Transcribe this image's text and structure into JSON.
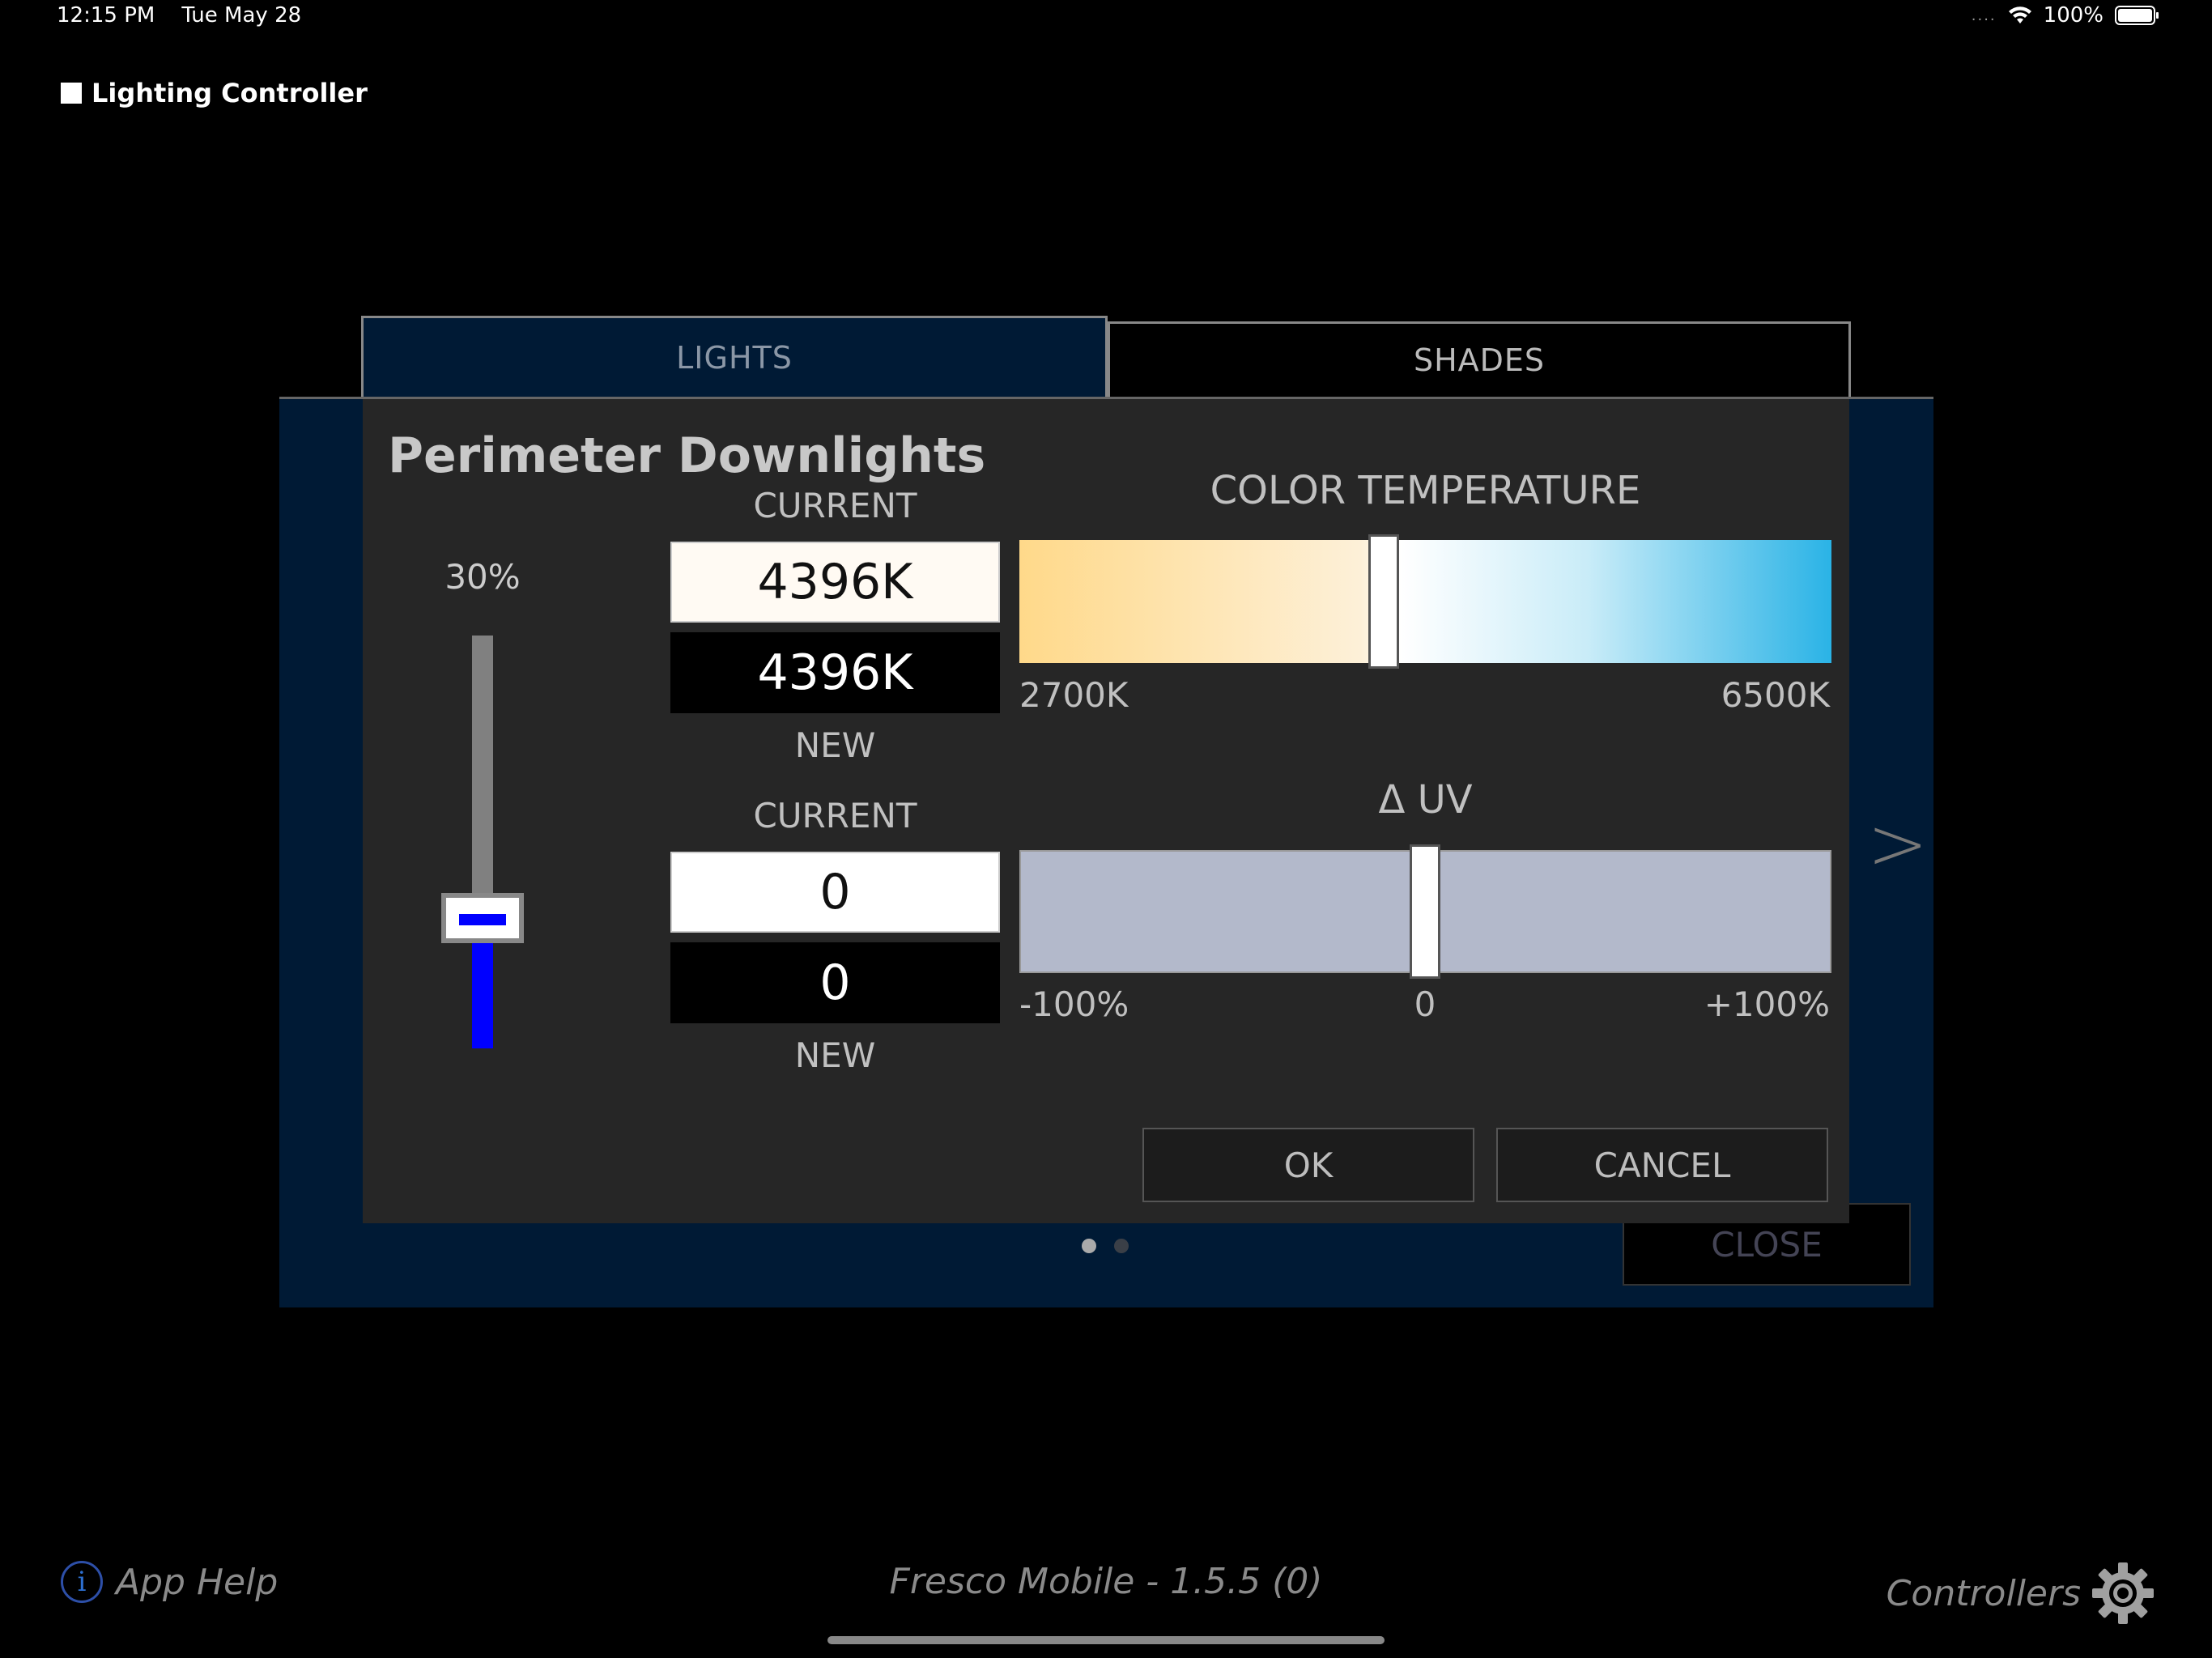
{
  "status_bar": {
    "time": "12:15 PM",
    "date": "Tue May 28",
    "signal": "....",
    "battery": "100%"
  },
  "app": {
    "title": "Lighting Controller"
  },
  "tabs": [
    {
      "label": "LIGHTS",
      "active": true
    },
    {
      "label": "SHADES",
      "active": false
    }
  ],
  "dialog": {
    "title": "Perimeter Downlights",
    "dimmer": {
      "label": "30%",
      "level_percent": 30
    },
    "color_temp": {
      "current_label": "CURRENT",
      "current_value": "4396K",
      "new_value": "4396K",
      "new_label": "NEW",
      "heading": "COLOR TEMPERATURE",
      "min_label": "2700K",
      "max_label": "6500K"
    },
    "uv": {
      "current_label": "CURRENT",
      "current_value": "0",
      "new_value": "0",
      "new_label": "NEW",
      "heading": "Δ UV",
      "min_label": "-100%",
      "mid_label": "0",
      "max_label": "+100%"
    },
    "ok_label": "OK",
    "cancel_label": "CANCEL"
  },
  "close_label": "CLOSE",
  "next_arrow": ">",
  "footer": {
    "help_label": "App Help",
    "version": "Fresco Mobile - 1.5.5 (0)",
    "controllers_label": "Controllers"
  },
  "colors": {
    "accent_blue": "#0000ff",
    "panel_navy": "#001a35",
    "dialog_bg": "#262626"
  },
  "icons": [
    "wifi-icon",
    "battery-icon",
    "info-icon",
    "gear-icon",
    "chevron-right-icon"
  ]
}
